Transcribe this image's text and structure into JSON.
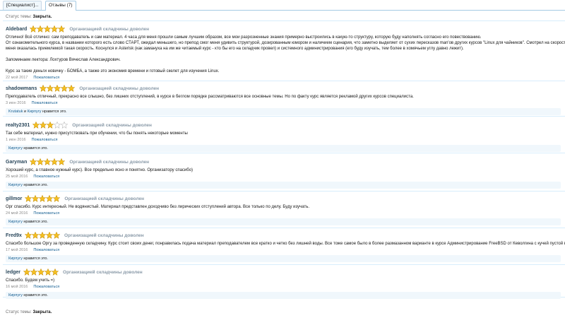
{
  "tabs": [
    {
      "label": "[Специалист]..."
    },
    {
      "label": "Отзывы (7)"
    }
  ],
  "status": {
    "label": "Статус темы:",
    "value": "Закрыта."
  },
  "complain_label": "Пожаловаться",
  "likes_suffix": "нравится это.",
  "and_word": "и",
  "reviews": [
    {
      "author": "Aldebard",
      "rating": 5,
      "badge": "Организацией складчины доволен",
      "lines": [
        "Отлично! Всё отлично: сам преподаватель и сам материал. 4 часа для меня прошли самым лучшим образом, все мои разрозненные знания примерно выстроились в какую-то структуру, которую буду наполнять согласно его повествованию.",
        "От ознакомительного курса, в названии которого есть слово СТАРТ, ожидал меньшего, но препод смог меня удивить структурой, дозированным юмором и наличием сценария, что заметно выделяет от сухих пересказов man'ов других курсов \"Linux для чайников\". Смотрел на скорости 1.5, для",
        "меня оказалась приемлемой такая скорость. Коснулся и Asterisk (как замануха на им же читаемый курс - кто бы его на складчик провел) и системного администрирования (его буду изучать, тем более в хомячьем углу давно лежит).",
        "",
        "Запоминаем лектора: Лохтуров Вячеслав Александрович.",
        "",
        "Курс за такие деньги новичку - БОМБА, а также это экономия времени и готовый скелет для изучения Linux."
      ],
      "date": "22 мой 2017",
      "likes": []
    },
    {
      "author": "shadowmans",
      "rating": 5,
      "badge": "Организацией складчины доволен",
      "lines": [
        "Преподаватель отличный, прекрасно все слышно, без лишних отступлений, в курсе в беглом порядке рассматриваются все основные темы. Но по факту курс является рекламой других курсов специалиста."
      ],
      "date": "3 июн 2016",
      "likes": [
        "Krutatuk",
        "Кирпугу"
      ]
    },
    {
      "author": "realty2301",
      "rating": 3,
      "badge": "Организацией складчины доволен",
      "lines": [
        "Так себе материал, нужно присутствовать при обучении, что бы понять некоторые моменты"
      ],
      "date": "1 июн 2016",
      "likes": [
        "Кирпугу"
      ]
    },
    {
      "author": "Garyman",
      "rating": 5,
      "badge": "Организацией складчины доволен",
      "lines": [
        "Хороший курс, а главное нужный курс). Все предельно ясно и понятно. Организатору спасибо)"
      ],
      "date": "25 мой 2016",
      "likes": [
        "Кирпугу"
      ]
    },
    {
      "author": "gillmor",
      "rating": 5,
      "badge": "Организацией складчины доволен",
      "lines": [
        "Орг спасибо. Курс интересный. Не водянистый. Материал представлен доходчиво без лирических отступлений автора. Все только по делу. Буду изучать."
      ],
      "date": "24 мой 2016",
      "likes": [
        "Кирпугу"
      ]
    },
    {
      "author": "Fred9x",
      "rating": 5,
      "badge": "Организацией складчины доволен",
      "lines": [
        "Спасибо большое Оргу за проведенную складчину. Курс стоит своих денег, понравилась подача материал преподавателем все кратко и четко без лишней воды. Все тоже самое было в более размазанном варианте в курсе Администрирование FreeBSD от Кеволгина с кучей пустой воды."
      ],
      "date": "17 мой 2016",
      "likes": [
        "Кирпугу"
      ]
    },
    {
      "author": "ledger",
      "rating": 5,
      "badge": "Организацией складчины доволен",
      "lines": [
        "Спасибо. Будем учить =)"
      ],
      "date": "16 мой 2016",
      "likes": [
        "Кирпугу"
      ]
    }
  ]
}
